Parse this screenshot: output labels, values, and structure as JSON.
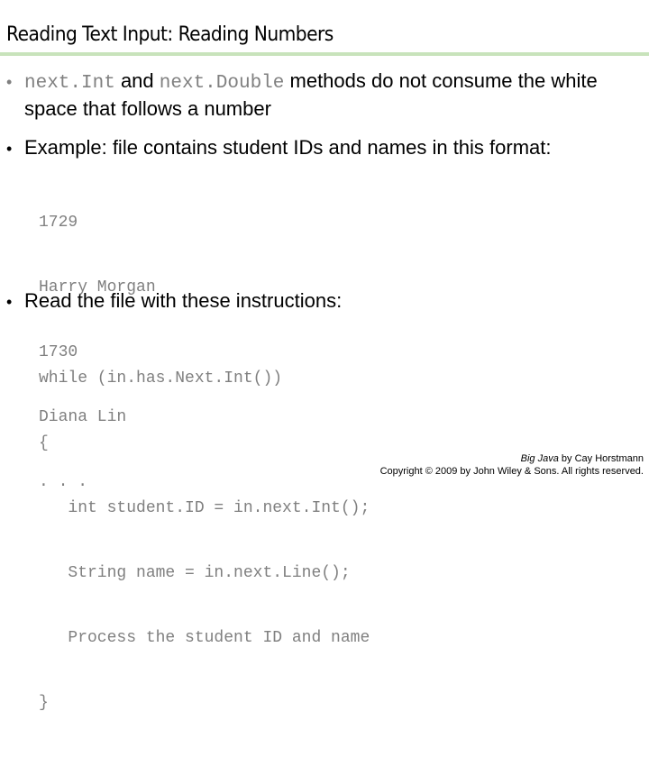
{
  "slide": {
    "title": "Reading Text Input: Reading Numbers",
    "accent_rule_color": "#c8e3bb"
  },
  "bullets": [
    {
      "parts": {
        "code1": "next.Int",
        "text1": " and ",
        "code2": "next.Double",
        "text2": " methods do not consume the white"
      },
      "continuation": "space that follows a number"
    },
    {
      "text": "Example: file contains student IDs and names in this format:",
      "code_lines": [
        "1729",
        "Harry Morgan",
        "1730",
        "Diana Lin",
        ". . ."
      ]
    },
    {
      "text": "Read the file with these instructions:",
      "code_lines": [
        "while (in.has.Next.Int())",
        "{",
        "   int student.ID = in.next.Int();",
        "   String name = in.next.Line();",
        "   Process the student ID and name",
        "}"
      ]
    }
  ],
  "footer": {
    "book_title": "Big Java",
    "byline": " by Cay Horstmann",
    "copyright": "Copyright © 2009 by John Wiley & Sons.  All rights reserved."
  }
}
